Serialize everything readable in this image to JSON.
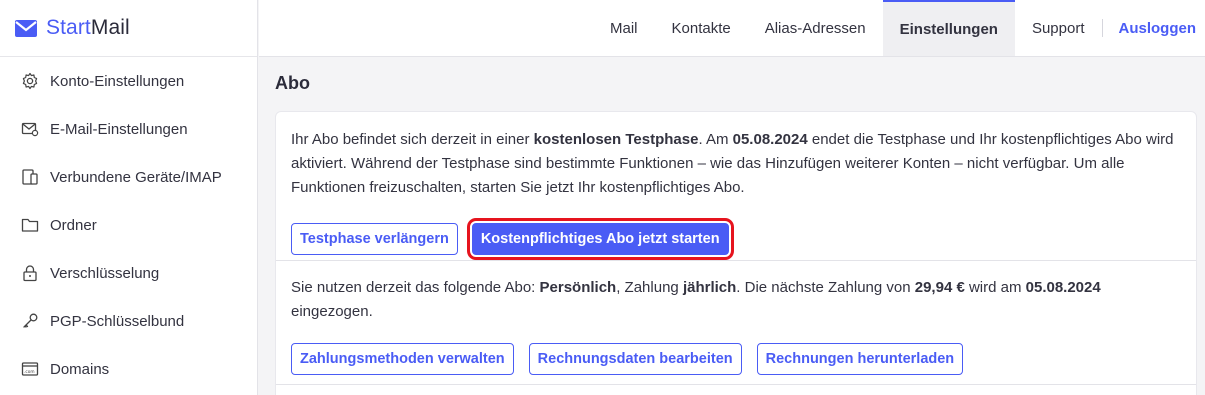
{
  "brand": {
    "name_part1": "Start",
    "name_part2": "Mail",
    "accent": "#4a5cf5"
  },
  "sidebar": {
    "items": [
      {
        "label": "Konto-Einstellungen",
        "icon": "gear-icon"
      },
      {
        "label": "E-Mail-Einstellungen",
        "icon": "mail-settings-icon"
      },
      {
        "label": "Verbundene Geräte/IMAP",
        "icon": "devices-icon"
      },
      {
        "label": "Ordner",
        "icon": "folder-icon"
      },
      {
        "label": "Verschlüsselung",
        "icon": "lock-icon"
      },
      {
        "label": "PGP-Schlüsselbund",
        "icon": "key-icon"
      },
      {
        "label": "Domains",
        "icon": "domain-icon"
      }
    ]
  },
  "topnav": {
    "mail": "Mail",
    "contacts": "Kontakte",
    "alias": "Alias-Adressen",
    "settings": "Einstellungen",
    "support": "Support",
    "logout": "Ausloggen"
  },
  "page": {
    "title": "Abo"
  },
  "trial": {
    "t1": "Ihr Abo befindet sich derzeit in einer ",
    "b1": "kostenlosen Testphase",
    "t2": ". Am ",
    "b2": "05.08.2024",
    "t3": " endet die Testphase und Ihr kostenpflichtiges Abo wird aktiviert. Während der Testphase sind bestimmte Funktionen – wie das Hinzufügen weiterer Konten – nicht verfügbar. Um alle Funktionen freizuschalten, starten Sie jetzt Ihr kostenpflichtiges Abo.",
    "extend_button": "Testphase verlängern",
    "start_button": "Kostenpflichtiges Abo jetzt starten"
  },
  "subscription": {
    "t1": "Sie nutzen derzeit das folgende Abo: ",
    "b1": "Persönlich",
    "t2": ", Zahlung ",
    "b2": "jährlich",
    "t3": ". Die nächste Zahlung von ",
    "b3": "29,94 €",
    "t4": " wird am ",
    "b4": "05.08.2024",
    "t5": " eingezogen.",
    "payment_button": "Zahlungsmethoden verwalten",
    "billing_button": "Rechnungsdaten bearbeiten",
    "invoices_button": "Rechnungen herunterladen"
  }
}
